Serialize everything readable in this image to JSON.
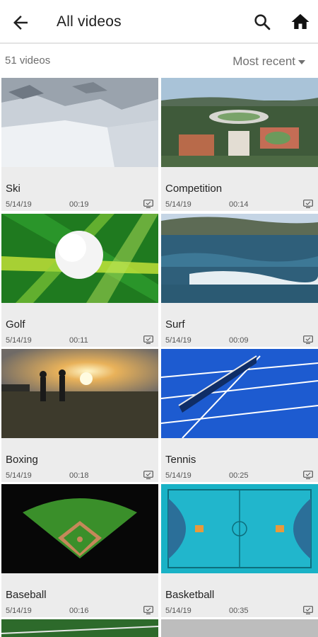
{
  "header": {
    "title": "All videos",
    "back_icon": "arrow-back-icon",
    "search_icon": "search-icon",
    "home_icon": "home-icon"
  },
  "summary": {
    "count_label": "51 videos",
    "sort_label": "Most recent"
  },
  "videos": [
    {
      "title": "Ski",
      "date": "5/14/19",
      "duration": "00:19",
      "icon": "tv-icon"
    },
    {
      "title": "Competition",
      "date": "5/14/19",
      "duration": "00:14",
      "icon": "tv-icon"
    },
    {
      "title": "Golf",
      "date": "5/14/19",
      "duration": "00:11",
      "icon": "tv-icon"
    },
    {
      "title": "Surf",
      "date": "5/14/19",
      "duration": "00:09",
      "icon": "tv-icon"
    },
    {
      "title": "Boxing",
      "date": "5/14/19",
      "duration": "00:18",
      "icon": "tv-icon"
    },
    {
      "title": "Tennis",
      "date": "5/14/19",
      "duration": "00:25",
      "icon": "tv-icon"
    },
    {
      "title": "Baseball",
      "date": "5/14/19",
      "duration": "00:16",
      "icon": "tv-icon"
    },
    {
      "title": "Basketball",
      "date": "5/14/19",
      "duration": "00:35",
      "icon": "tv-icon"
    }
  ],
  "colors": {
    "card_bg": "#ececec",
    "header_divider": "#e3e3e3",
    "text_primary": "#202020",
    "text_secondary": "#6d6d6d"
  }
}
